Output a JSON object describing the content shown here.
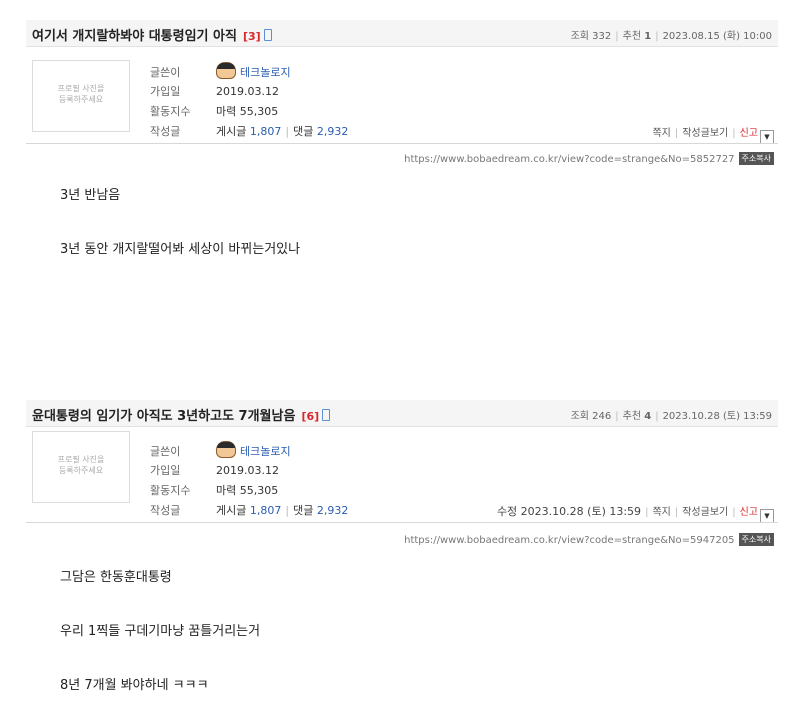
{
  "posts": [
    {
      "title": "여기서 개지랄하봐야 대통령임기 아직",
      "comment_count": "[3]",
      "views": "조회 332",
      "recommend_label": "추천",
      "recommend_count": "1",
      "date": "2023.08.15 (화) 10:00",
      "profile_placeholder": [
        "프로필 사진을",
        "등록하주세요"
      ],
      "author_label": "글쓴이",
      "author": "테크놀로지",
      "joined_label": "가입일",
      "joined": "2019.03.12",
      "activity_label": "활동지수",
      "activity": "마력 55,305",
      "writings_label": "작성글",
      "posts_label": "게시글",
      "posts_count": "1,807",
      "comments_label": "댓글",
      "comments_count": "2,932",
      "edited": "",
      "note": "쪽지",
      "view_posts": "작성글보기",
      "report": "신고",
      "url": "https://www.bobaedream.co.kr/view?code=strange&No=5852727",
      "copy_label": "주소복사",
      "content": [
        "3년 반남음",
        "",
        "3년 동안 개지랄떨어봐 세상이 바뀌는거있나"
      ]
    },
    {
      "title": "윤대통령의 임기가 아직도 3년하고도 7개월남음",
      "comment_count": "[6]",
      "views": "조회 246",
      "recommend_label": "추천",
      "recommend_count": "4",
      "date": "2023.10.28 (토) 13:59",
      "profile_placeholder": [
        "프로필 사진을",
        "등록하주세요"
      ],
      "author_label": "글쓴이",
      "author": "테크놀로지",
      "joined_label": "가입일",
      "joined": "2019.03.12",
      "activity_label": "활동지수",
      "activity": "마력 55,305",
      "writings_label": "작성글",
      "posts_label": "게시글",
      "posts_count": "1,807",
      "comments_label": "댓글",
      "comments_count": "2,932",
      "edited": "수정 2023.10.28 (토) 13:59",
      "note": "쪽지",
      "view_posts": "작성글보기",
      "report": "신고",
      "url": "https://www.bobaedream.co.kr/view?code=strange&No=5947205",
      "copy_label": "주소복사",
      "content": [
        "그담은 한동훈대통령",
        "",
        "우리 1찍들 구데기마냥 꿈틀거리는거",
        "",
        "8년 7개월 봐야하네 ㅋㅋㅋ"
      ]
    }
  ]
}
